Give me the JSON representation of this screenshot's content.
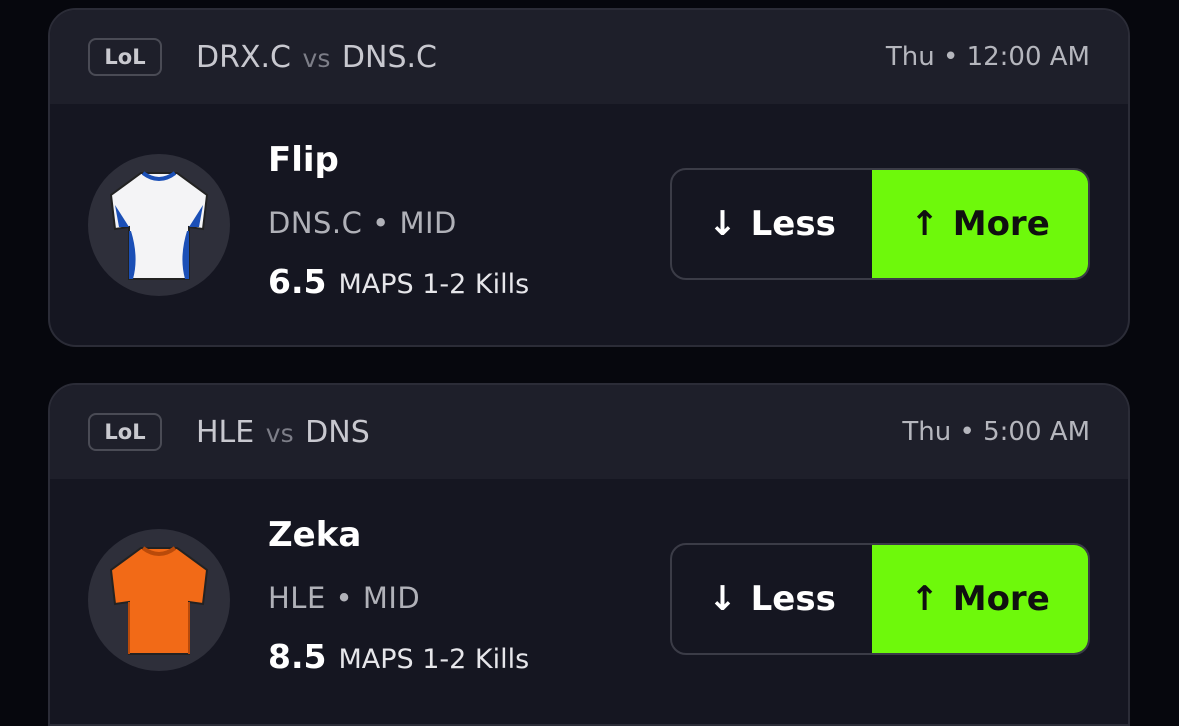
{
  "cards": [
    {
      "badge": "LoL",
      "team_a": "DRX.C",
      "vs": "vs",
      "team_b": "DNS.C",
      "time": "Thu • 12:00 AM",
      "player": "Flip",
      "team_position": "DNS.C • MID",
      "line_value": "6.5",
      "stat": "MAPS 1-2 Kills",
      "less_label": "Less",
      "more_label": "More",
      "jersey_color": "#ffffff"
    },
    {
      "badge": "LoL",
      "team_a": "HLE",
      "vs": "vs",
      "team_b": "DNS",
      "time": "Thu • 5:00 AM",
      "player": "Zeka",
      "team_position": "HLE • MID",
      "line_value": "8.5",
      "stat": "MAPS 1-2 Kills",
      "less_label": "Less",
      "more_label": "More",
      "jersey_color": "#f26a17"
    }
  ],
  "colors": {
    "more_button": "#6ef90b",
    "card_bg": "#151621",
    "page_bg": "#06070d"
  },
  "icons": {
    "less": "arrow-down-icon",
    "more": "arrow-up-icon"
  }
}
